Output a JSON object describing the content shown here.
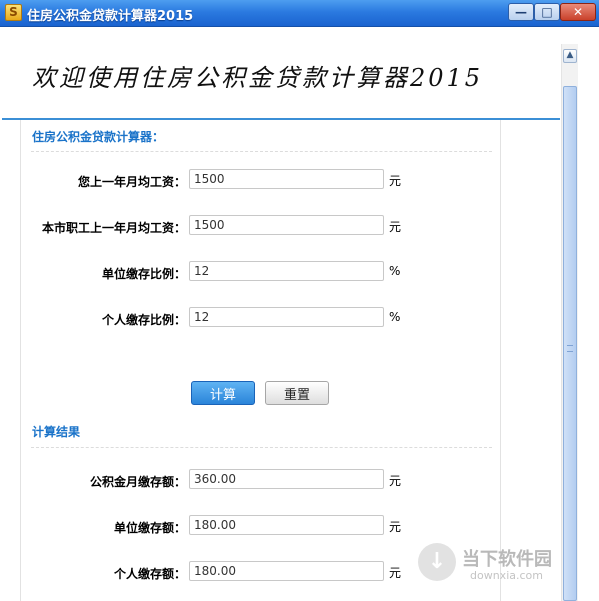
{
  "window": {
    "title": "住房公积金贷款计算器2015",
    "app_icon_glyph": "S",
    "min_glyph": "—",
    "max_glyph": "□",
    "close_glyph": "✕"
  },
  "banner": {
    "heading": "欢迎使用住房公积金贷款计算器2015"
  },
  "calculator": {
    "section_title": "住房公积金贷款计算器：",
    "fields": [
      {
        "label": "您上一年月均工资：",
        "value": "1500",
        "unit": "元"
      },
      {
        "label": "本市职工上一年月均工资：",
        "value": "1500",
        "unit": "元"
      },
      {
        "label": "单位缴存比例：",
        "value": "12",
        "unit": "%"
      },
      {
        "label": "个人缴存比例：",
        "value": "12",
        "unit": "%"
      }
    ],
    "calc_button": "计算",
    "reset_button": "重置"
  },
  "results": {
    "section_title": "计算结果",
    "fields": [
      {
        "label": "公积金月缴存额：",
        "value": "360.00",
        "unit": "元"
      },
      {
        "label": "单位缴存额：",
        "value": "180.00",
        "unit": "元"
      },
      {
        "label": "个人缴存额：",
        "value": "180.00",
        "unit": "元"
      }
    ]
  },
  "scrollbar": {
    "up_glyph": "▲"
  },
  "watermark": {
    "glyph": "↓",
    "name": "当下软件园",
    "url": "downxia.com"
  },
  "colors": {
    "accent": "#1a73c9",
    "titlebar": "#2b7ae0",
    "primary_button": "#2a84d9"
  }
}
